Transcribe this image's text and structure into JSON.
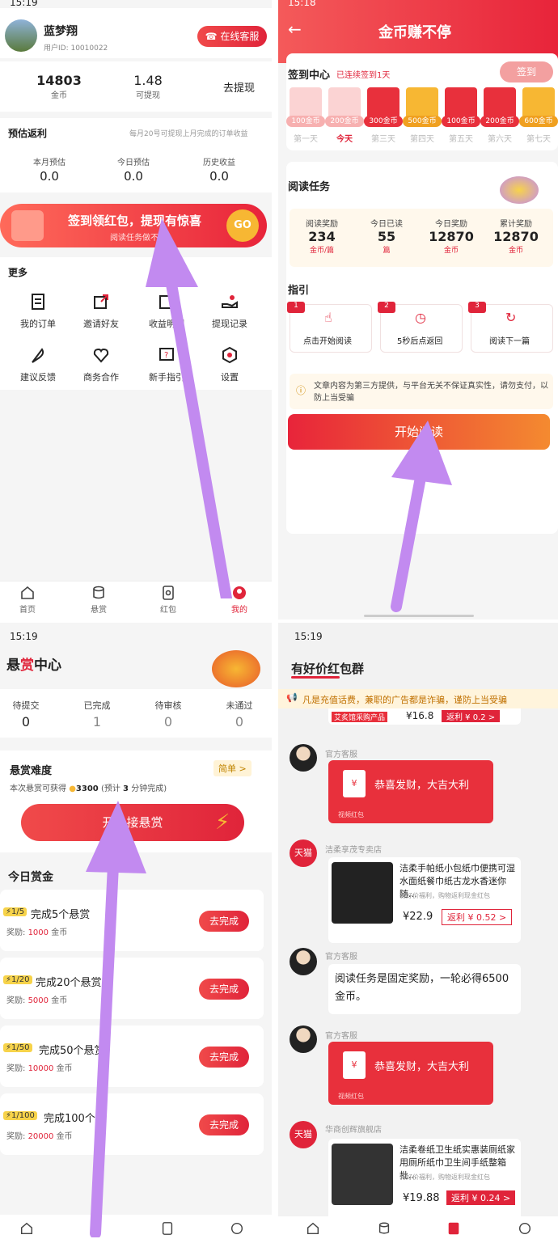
{
  "p1": {
    "status_time": "15:19",
    "user": {
      "name": "蓝梦翔",
      "id_label": "用户ID: 10010022"
    },
    "service_button": "在线客服",
    "stats": [
      {
        "value": "14803",
        "label": "金币"
      },
      {
        "value": "1.48",
        "label": "可提现"
      }
    ],
    "withdraw_label": "去提现",
    "rebate": {
      "title": "预估返利",
      "note": "每月20号可提现上月完成的订单收益",
      "items": [
        {
          "label": "本月预估",
          "value": "0.0"
        },
        {
          "label": "今日预估",
          "value": "0.0"
        },
        {
          "label": "历史收益",
          "value": "0.0"
        }
      ]
    },
    "banner": {
      "title": "签到领红包，提现有惊喜",
      "subtitle": "阅读任务做不停",
      "go": "GO"
    },
    "more": {
      "title": "更多",
      "items": [
        "我的订单",
        "邀请好友",
        "收益明细",
        "提现记录",
        "建议反馈",
        "商务合作",
        "新手指引",
        "设置"
      ],
      "icons": [
        "document-icon",
        "share-icon",
        "wallet-icon",
        "withdraw-hand-icon",
        "feather-icon",
        "handshake-heart-icon",
        "help-icon",
        "settings-icon"
      ]
    },
    "tabs": [
      "首页",
      "悬赏",
      "红包",
      "我的"
    ]
  },
  "p2": {
    "status_time": "15:18",
    "title": "金币赚不停",
    "checkin": {
      "title": "签到中心",
      "streak": "已连续签到1天",
      "button": "签到",
      "days": [
        {
          "value": "100金币",
          "label": "第一天",
          "state": "done"
        },
        {
          "value": "200金币",
          "label": "今天",
          "state": "today"
        },
        {
          "value": "300金币",
          "label": "第三天",
          "state": "red"
        },
        {
          "value": "500金币",
          "label": "第四天",
          "state": "gold"
        },
        {
          "value": "100金币",
          "label": "第五天",
          "state": "red"
        },
        {
          "value": "200金币",
          "label": "第六天",
          "state": "red"
        },
        {
          "value": "600金币",
          "label": "第七天",
          "state": "gold"
        }
      ]
    },
    "reading": {
      "title": "阅读任务",
      "stats": [
        {
          "label": "阅读奖励",
          "value": "234",
          "unit": "金币/篇"
        },
        {
          "label": "今日已读",
          "value": "55",
          "unit": "篇"
        },
        {
          "label": "今日奖励",
          "value": "12870",
          "unit": "金币"
        },
        {
          "label": "累计奖励",
          "value": "12870",
          "unit": "金币"
        }
      ]
    },
    "guide": {
      "title": "指引",
      "steps": [
        {
          "num": "1",
          "label": "点击开始阅读",
          "icon": "tap-icon"
        },
        {
          "num": "2",
          "label": "5秒后点返回",
          "icon": "clock-icon"
        },
        {
          "num": "3",
          "label": "阅读下一篇",
          "icon": "refresh-icon"
        }
      ]
    },
    "notice": "文章内容为第三方提供，与平台无关不保证真实性，请勿支付，以防上当受骗",
    "start_button": "开始阅读"
  },
  "p3": {
    "status_time": "15:19",
    "title_a": "悬",
    "title_b": "赏",
    "title_c": "中心",
    "counts": [
      {
        "label": "待提交",
        "value": "0"
      },
      {
        "label": "已完成",
        "value": "1"
      },
      {
        "label": "待审核",
        "value": "0"
      },
      {
        "label": "未通过",
        "value": "0"
      }
    ],
    "difficulty": {
      "title": "悬赏难度",
      "level": "简单 >",
      "desc_a": "本次悬赏可获得",
      "coins": "3300",
      "desc_b": "(预计",
      "minutes": "3",
      "desc_c": "分钟完成)"
    },
    "start_button": "开始接悬赏",
    "today_title": "今日赏金",
    "tasks": [
      {
        "badge": "1/5",
        "title": "完成5个悬赏",
        "reward_prefix": "奖励:",
        "reward": "1000",
        "unit": "金币",
        "button": "去完成"
      },
      {
        "badge": "1/20",
        "title": "完成20个悬赏",
        "reward_prefix": "奖励:",
        "reward": "5000",
        "unit": "金币",
        "button": "去完成"
      },
      {
        "badge": "1/50",
        "title": "完成50个悬赏",
        "reward_prefix": "奖励:",
        "reward": "10000",
        "unit": "金币",
        "button": "去完成"
      },
      {
        "badge": "1/100",
        "title": "完成100个悬",
        "reward_prefix": "奖励:",
        "reward": "20000",
        "unit": "金币",
        "button": "去完成"
      }
    ]
  },
  "p4": {
    "status_time": "15:19",
    "title": "有好价红包群",
    "warning": "凡是充值话费，兼职的广告都是诈骗，谨防上当受骗",
    "top_product": {
      "tag": "艾炙馆采购产品",
      "price": "¥16.8",
      "rebate": "返利 ¥ 0.2 >"
    },
    "messages": [
      {
        "type": "redpack",
        "name": "官方客服",
        "text": "恭喜发财，大吉大利",
        "sub": "视频红包"
      },
      {
        "type": "product",
        "name": "洁柔享茂专卖店",
        "badge": "天猫",
        "desc": "洁柔手帕纸小包纸巾便携可湿水面纸餐巾纸古龙水香迷你随...",
        "note": "有好价福利，购物返利现金红包",
        "price": "¥22.9",
        "rebate": "返利 ¥ 0.52 >"
      },
      {
        "type": "text",
        "name": "官方客服",
        "text": "阅读任务是固定奖励，一轮必得6500金币。"
      },
      {
        "type": "redpack",
        "name": "官方客服",
        "text": "恭喜发财，大吉大利",
        "sub": "视频红包"
      },
      {
        "type": "product",
        "name": "华商创辉旗舰店",
        "badge": "天猫",
        "desc": "洁柔卷纸卫生纸实惠装厕纸家用厕所纸巾卫生间手纸整箱批...",
        "note": "有好价福利，购物返利现金红包",
        "price": "¥19.88",
        "rebate": "返利 ¥ 0.24 >"
      }
    ]
  }
}
